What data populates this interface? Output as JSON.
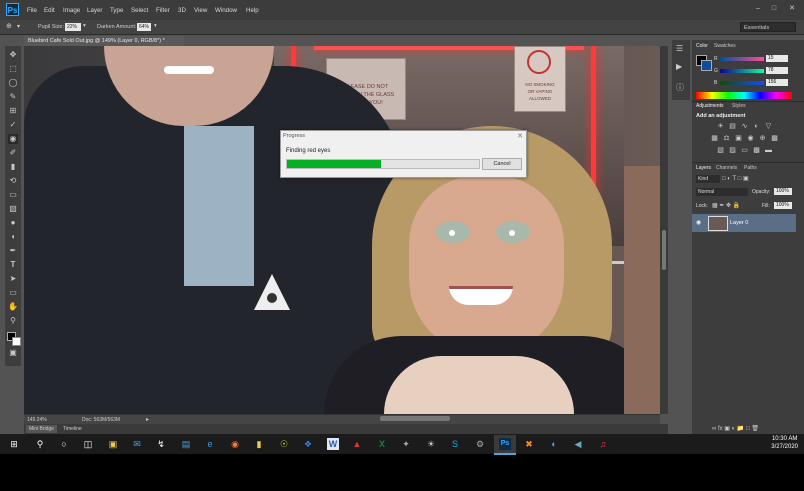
{
  "menubar": {
    "logo": "Ps",
    "items": [
      "File",
      "Edit",
      "Image",
      "Layer",
      "Type",
      "Select",
      "Filter",
      "3D",
      "View",
      "Window",
      "Help"
    ]
  },
  "optionsbar": {
    "pupil_size_label": "Pupil Size:",
    "pupil_size_value": "22%",
    "darken_label": "Darken Amount:",
    "darken_value": "64%",
    "workspace": "Essentials"
  },
  "document": {
    "tab_title": "Bluebird Cafe Sold Out.jpg @ 149% (Layer 0, RGB/8*) *",
    "zoom": "149.24%",
    "doc_size": "Doc: 563M/563M",
    "bottom_tabs": [
      "Mini Bridge",
      "Timeline"
    ]
  },
  "photo": {
    "sign_left": "PLEASE DO NOT\nLEAN ON THE GLASS\nTHANK YOU!",
    "sign_right": "NO SMOKING\nOR VAPING\nALLOWED"
  },
  "progress_dialog": {
    "title": "Progress",
    "status": "Finding red eyes",
    "cancel_label": "Cancel",
    "progress_fraction": 0.49
  },
  "color_panel": {
    "tabs": [
      "Color",
      "Swatches"
    ],
    "r_label": "R",
    "r_value": "15",
    "g_label": "G",
    "g_value": "78",
    "b_label": "B",
    "b_value": "156"
  },
  "adjustments_panel": {
    "tabs": [
      "Adjustments",
      "Styles"
    ],
    "heading": "Add an adjustment"
  },
  "layers_panel": {
    "tabs": [
      "Layers",
      "Channels",
      "Paths"
    ],
    "kind": "Kind",
    "blend_mode": "Normal",
    "opacity_label": "Opacity:",
    "opacity_value": "100%",
    "lock_label": "Lock:",
    "fill_label": "Fill:",
    "fill_value": "100%",
    "layer_name": "Layer 0"
  },
  "taskbar": {
    "time": "10:30 AM",
    "date": "3/27/2020",
    "ps_label": "Ps"
  },
  "colors": {
    "progress_green": "#06b025",
    "neon_red": "#ff2a2a",
    "ps_blue": "#31a8ff"
  }
}
